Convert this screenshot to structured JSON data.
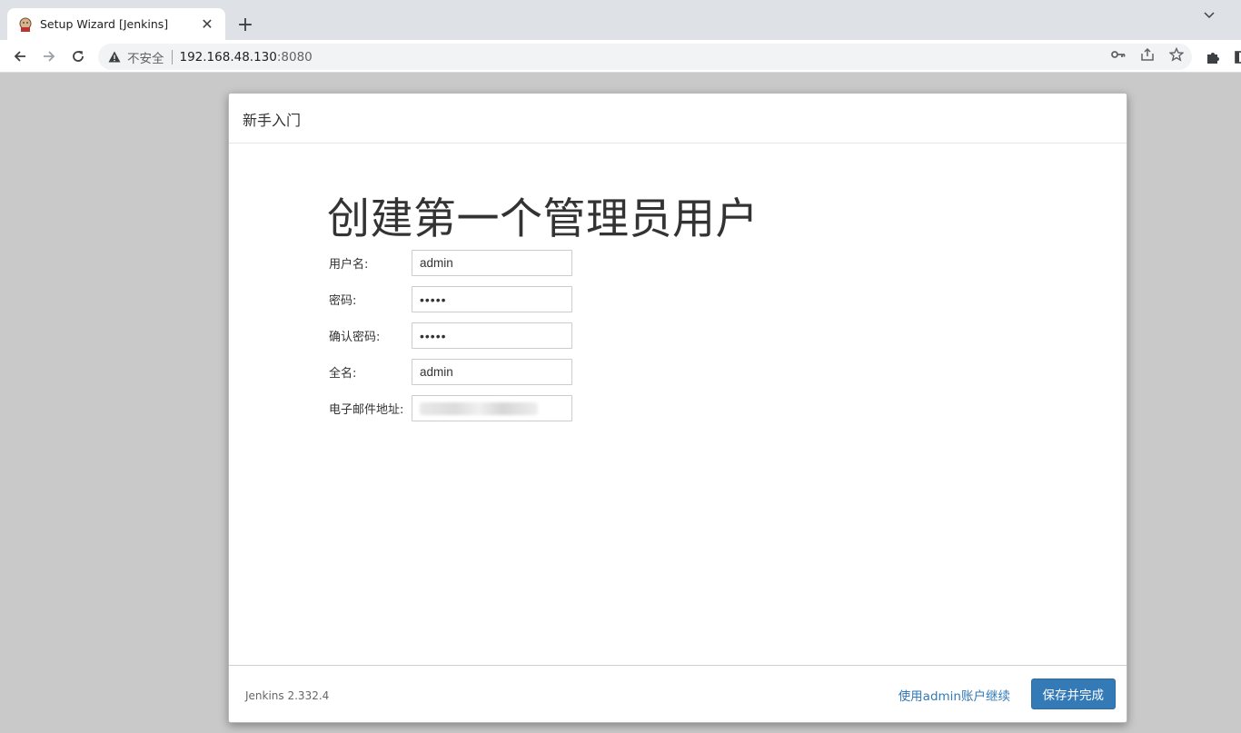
{
  "browser": {
    "tab_title": "Setup Wizard [Jenkins]",
    "insecure_label": "不安全",
    "url_host": "192.168.48.130",
    "url_port": ":8080"
  },
  "dialog": {
    "header_title": "新手入门",
    "page_title": "创建第一个管理员用户",
    "fields": {
      "username": {
        "label": "用户名:",
        "value": "admin"
      },
      "password": {
        "label": "密码:",
        "value": "•••••"
      },
      "confirm_password": {
        "label": "确认密码:",
        "value": "•••••"
      },
      "full_name": {
        "label": "全名:",
        "value": "admin"
      },
      "email": {
        "label": "电子邮件地址:"
      }
    },
    "footer": {
      "version": "Jenkins 2.332.4",
      "continue_link": "使用admin账户继续",
      "save_button": "保存并完成"
    }
  },
  "colors": {
    "primary": "#337ab7",
    "backdrop": "#c9c9c9"
  }
}
